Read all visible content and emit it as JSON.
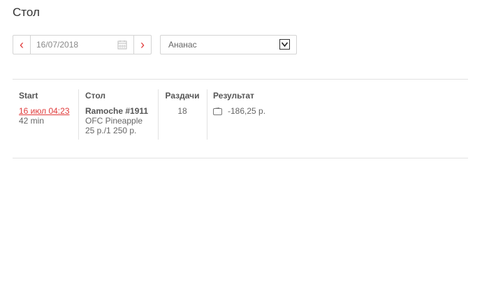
{
  "page": {
    "title": "Стол"
  },
  "filters": {
    "date_value": "16/07/2018",
    "select_value": "Ананас"
  },
  "table": {
    "headers": {
      "start": "Start",
      "table": "Стол",
      "deals": "Раздачи",
      "result": "Результат"
    },
    "row": {
      "start_datetime": "16 июл 04:23",
      "duration": "42 min",
      "table_name": "Ramoche #1911",
      "game_type": "OFC Pineapple",
      "stakes": "25 р./1 250 р.",
      "deals": "18",
      "result": "-186,25 р."
    }
  },
  "colors": {
    "accent": "#e03a3a",
    "border": "#d4d4d4",
    "rule": "#e2e2e2"
  }
}
